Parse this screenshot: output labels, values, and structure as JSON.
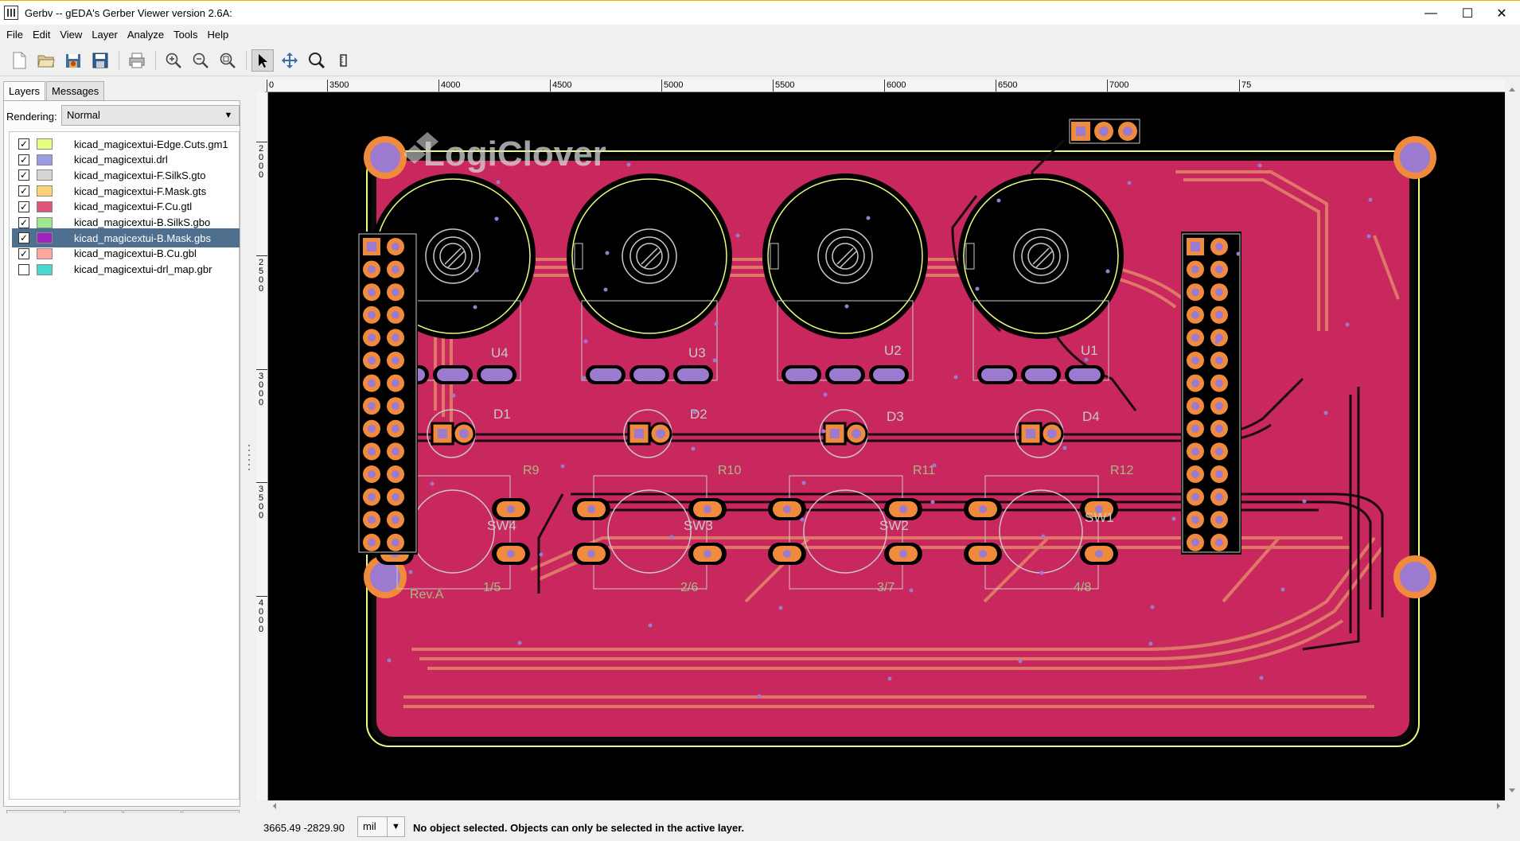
{
  "window": {
    "title": "Gerbv -- gEDA's Gerber Viewer version 2.6A:",
    "minimize": "—",
    "maximize": "☐",
    "close": "✕"
  },
  "menu": [
    "File",
    "Edit",
    "View",
    "Layer",
    "Analyze",
    "Tools",
    "Help"
  ],
  "toolbar": {
    "buttons": [
      "new-icon",
      "open-icon",
      "revert-icon",
      "save-icon",
      "print-icon",
      "zoom-in-icon",
      "zoom-out-icon",
      "zoom-fit-icon",
      "pointer-tool-icon",
      "pan-tool-icon",
      "zoom-tool-icon",
      "measure-tool-icon"
    ],
    "active_tool": "pointer-tool-icon"
  },
  "panel": {
    "tabs": [
      "Layers",
      "Messages"
    ],
    "active_tab": "Layers",
    "rendering_label": "Rendering:",
    "rendering_value": "Normal"
  },
  "layers": [
    {
      "name": "kicad_magicextui-Edge.Cuts.gm1",
      "color": "#e6ff80",
      "checked": true,
      "selected": false
    },
    {
      "name": "kicad_magicextui.drl",
      "color": "#9c9ce6",
      "checked": true,
      "selected": false
    },
    {
      "name": "kicad_magicextui-F.SilkS.gto",
      "color": "#d6d6d6",
      "checked": true,
      "selected": false
    },
    {
      "name": "kicad_magicextui-F.Mask.gts",
      "color": "#ffd27a",
      "checked": true,
      "selected": false
    },
    {
      "name": "kicad_magicextui-F.Cu.gtl",
      "color": "#e0557a",
      "checked": true,
      "selected": false
    },
    {
      "name": "kicad_magicextui-B.SilkS.gbo",
      "color": "#a0e890",
      "checked": true,
      "selected": false
    },
    {
      "name": "kicad_magicextui-B.Mask.gbs",
      "color": "#a020c0",
      "checked": true,
      "selected": true
    },
    {
      "name": "kicad_magicextui-B.Cu.gbl",
      "color": "#ffa69e",
      "checked": true,
      "selected": false
    },
    {
      "name": "kicad_magicextui-drl_map.gbr",
      "color": "#48d8d0",
      "checked": false,
      "selected": false
    }
  ],
  "layer_buttons": [
    "add-layer-icon",
    "move-layer-down-icon",
    "move-layer-up-icon",
    "remove-layer-icon"
  ],
  "ruler": {
    "top": [
      "0",
      "3500",
      "4000",
      "4500",
      "5000",
      "5500",
      "6000",
      "6500",
      "7000",
      "75"
    ],
    "left": [
      "2000",
      "2500",
      "3000",
      "3500",
      "4000"
    ]
  },
  "pcb_labels": {
    "logo": "LogiClover",
    "components": [
      "U4",
      "U3",
      "U2",
      "U1",
      "D1",
      "D2",
      "D3",
      "D4",
      "SW4",
      "SW3",
      "SW2",
      "SW1"
    ],
    "back_labels": [
      "R9",
      "R10",
      "R11",
      "R12",
      "1/5",
      "2/6",
      "3/7",
      "4/8",
      "Rev.A"
    ]
  },
  "status": {
    "coordinates": "3665.49 -2829.90",
    "unit": "mil",
    "message": "No object selected. Objects can only be selected in the active layer."
  },
  "colors": {
    "board": "#c8285e",
    "trace": "#e3856a",
    "pad": "#f08a3c",
    "drill": "#9c7ad0",
    "silk": "#c8c8c8",
    "edge": "#e6ff80",
    "bsilk": "#a0e890"
  }
}
